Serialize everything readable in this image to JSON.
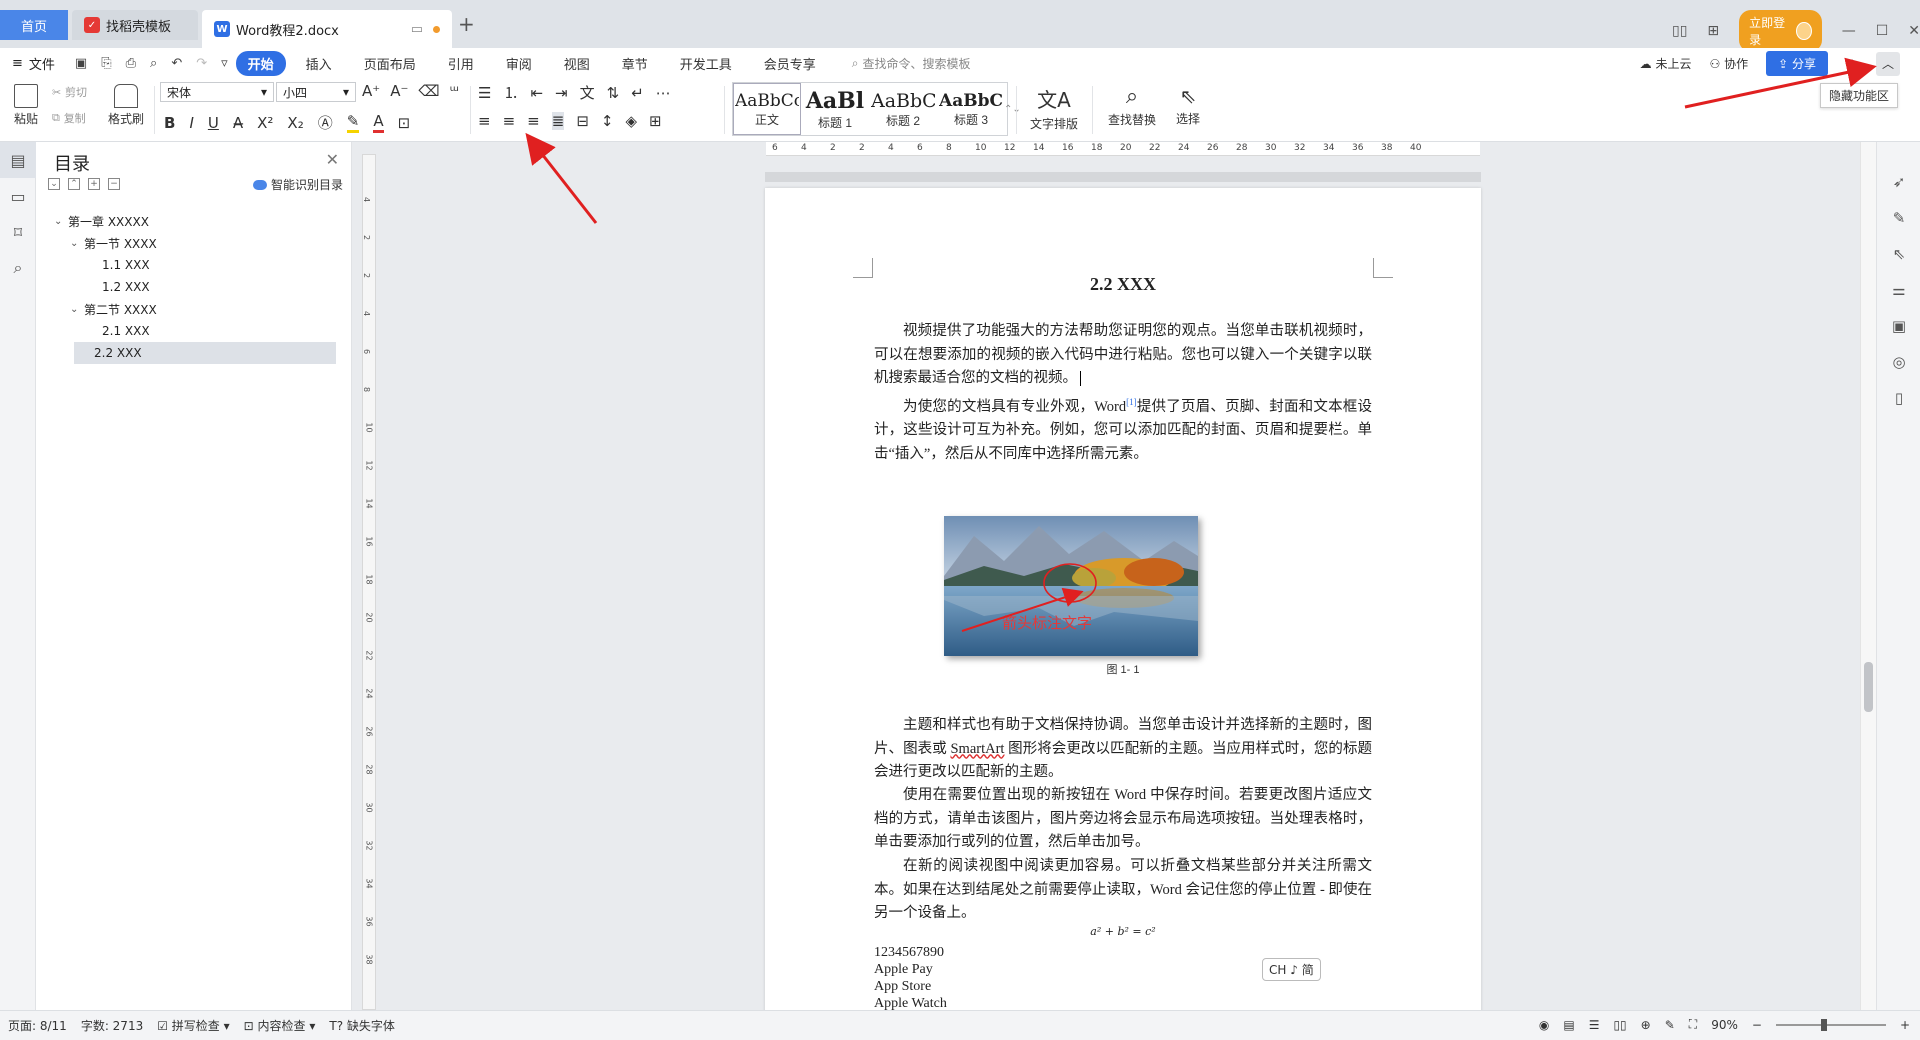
{
  "tabs": {
    "home": "首页",
    "template": "找稻壳模板",
    "document": "Word教程2.docx"
  },
  "window": {
    "login": "立即登录"
  },
  "menubar": {
    "file": "文件",
    "tabs": [
      "开始",
      "插入",
      "页面布局",
      "引用",
      "审阅",
      "视图",
      "章节",
      "开发工具",
      "会员专享"
    ],
    "search_placeholder": "查找命令、搜索模板",
    "cloud": "未上云",
    "collab": "协作",
    "share": "分享"
  },
  "ribbon": {
    "paste": "粘贴",
    "cut": "剪切",
    "copy": "复制",
    "format_painter": "格式刷",
    "font_name": "宋体",
    "font_size": "小四",
    "styles": [
      {
        "sample": "AaBbCcI",
        "name": "正文"
      },
      {
        "sample": "AaBl",
        "name": "标题 1"
      },
      {
        "sample": "AaBbC",
        "name": "标题 2"
      },
      {
        "sample": "AaBbC",
        "name": "标题 3"
      }
    ],
    "text_layout": "文字排版",
    "find_replace": "查找替换",
    "select": "选择",
    "tooltip": "隐藏功能区"
  },
  "toc": {
    "title": "目录",
    "smart": "智能识别目录",
    "items": [
      {
        "label": "第一章 XXXXX",
        "level": 1
      },
      {
        "label": "第一节 XXXX",
        "level": 2
      },
      {
        "label": "1.1 XXX",
        "level": 3
      },
      {
        "label": "1.2 XXX",
        "level": 3
      },
      {
        "label": "第二节 XXXX",
        "level": 2
      },
      {
        "label": "2.1 XXX",
        "level": 3
      },
      {
        "label": "2.2 XXX",
        "level": 3
      }
    ]
  },
  "ruler": {
    "h_ticks": [
      "6",
      "4",
      "2",
      "2",
      "4",
      "6",
      "8",
      "10",
      "12",
      "14",
      "16",
      "18",
      "20",
      "22",
      "24",
      "26",
      "28",
      "30",
      "32",
      "34",
      "36",
      "38",
      "40"
    ],
    "v_ticks": [
      "4",
      "2",
      "2",
      "4",
      "6",
      "8",
      "10",
      "12",
      "14",
      "16",
      "18",
      "20",
      "22",
      "24",
      "26",
      "28",
      "30",
      "32",
      "34",
      "36",
      "38"
    ]
  },
  "document": {
    "heading": "2.2 XXX",
    "p1": "视频提供了功能强大的方法帮助您证明您的观点。当您单击联机视频时，可以在想要添加的视频的嵌入代码中进行粘贴。您也可以键入一个关键字以联机搜索最适合您的文档的视频。",
    "p2_a": "为使您的文档具有专业外观，Word",
    "p2_sup": "[1]",
    "p2_b": "提供了页眉、页脚、封面和文本框设计，这些设计可互为补充。例如，您可以添加匹配的封面、页眉和提要栏。单击“插入”，然后从不同库中选择所需元素。",
    "figure_label": "箭头标注文字",
    "figure_caption": "图 1- 1",
    "p3_a": "主题和样式也有助于文档保持协调。当您单击设计并选择新的主题时，图片、图表或 ",
    "p3_smartart": "SmartArt",
    "p3_b": " 图形将会更改以匹配新的主题。当应用样式时，您的标题会进行更改以匹配新的主题。",
    "p4": "使用在需要位置出现的新按钮在 Word 中保存时间。若要更改图片适应文档的方式，请单击该图片，图片旁边将会显示布局选项按钮。当处理表格时，单击要添加行或列的位置，然后单击加号。",
    "p5": "在新的阅读视图中阅读更加容易。可以折叠文档某些部分并关注所需文本。如果在达到结尾处之前需要停止读取，Word 会记住您的停止位置 - 即使在另一个设备上。",
    "formula": "a² + b² = c²",
    "list": [
      "1234567890",
      "Apple Pay",
      "App Store",
      "Apple Watch"
    ]
  },
  "ime": "CH ♪ 简",
  "status": {
    "page": "页面: 8/11",
    "words": "字数: 2713",
    "spell": "拼写检查",
    "content": "内容检查",
    "missing_font": "缺失字体",
    "zoom": "90%"
  },
  "colors": {
    "accent": "#2f6fe4",
    "arrow": "#e02020"
  }
}
